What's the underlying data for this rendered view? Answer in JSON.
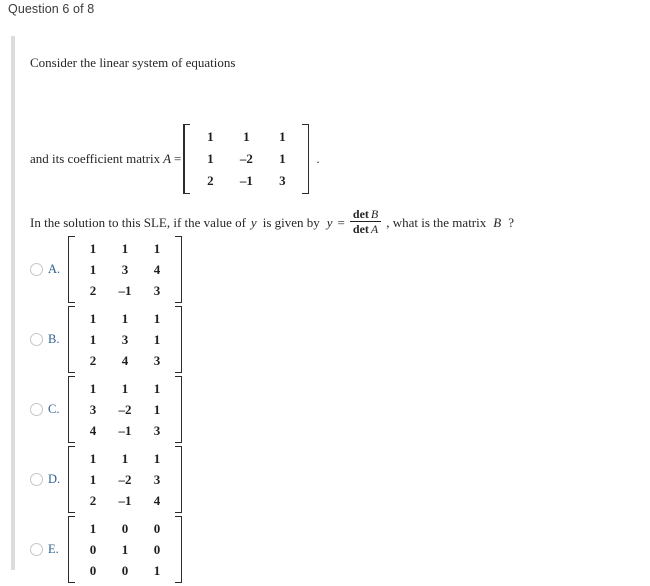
{
  "header": {
    "question_counter": "Question 6 of 8"
  },
  "question": {
    "intro_text": "Consider the linear system of equations",
    "coefficient_label": "and its coefficient matrix",
    "coefficient_var": "A",
    "equals": "=",
    "period": ".",
    "coefficient_matrix": [
      [
        "1",
        "1",
        "1"
      ],
      [
        "1",
        "–2",
        "1"
      ],
      [
        "2",
        "–1",
        "3"
      ]
    ],
    "sle_text_before": "In the solution to this SLE, if the value of",
    "sle_var_y": "y",
    "sle_text_mid": "is given by",
    "sle_y_again": "y",
    "sle_equals": "=",
    "fraction_numerator_word": "det",
    "fraction_numerator_arg": "B",
    "fraction_denominator_word": "det",
    "fraction_denominator_arg": "A",
    "sle_text_after": ", what is the matrix",
    "sle_var_b": "B",
    "sle_question_mark": "?"
  },
  "options": [
    {
      "letter": "A.",
      "selected": false,
      "matrix": [
        [
          "1",
          "1",
          "1"
        ],
        [
          "1",
          "3",
          "4"
        ],
        [
          "2",
          "–1",
          "3"
        ]
      ]
    },
    {
      "letter": "B.",
      "selected": false,
      "matrix": [
        [
          "1",
          "1",
          "1"
        ],
        [
          "1",
          "3",
          "1"
        ],
        [
          "2",
          "4",
          "3"
        ]
      ]
    },
    {
      "letter": "C.",
      "selected": false,
      "matrix": [
        [
          "1",
          "1",
          "1"
        ],
        [
          "3",
          "–2",
          "1"
        ],
        [
          "4",
          "–1",
          "3"
        ]
      ]
    },
    {
      "letter": "D.",
      "selected": false,
      "matrix": [
        [
          "1",
          "1",
          "1"
        ],
        [
          "1",
          "–2",
          "3"
        ],
        [
          "2",
          "–1",
          "4"
        ]
      ]
    },
    {
      "letter": "E.",
      "selected": false,
      "matrix": [
        [
          "1",
          "0",
          "0"
        ],
        [
          "0",
          "1",
          "0"
        ],
        [
          "0",
          "0",
          "1"
        ]
      ]
    }
  ],
  "colors": {
    "accent_bar": "#dcdcdc",
    "option_letter": "#2f5f8f",
    "text": "#262626",
    "radio_border": "#c6c6c6"
  }
}
